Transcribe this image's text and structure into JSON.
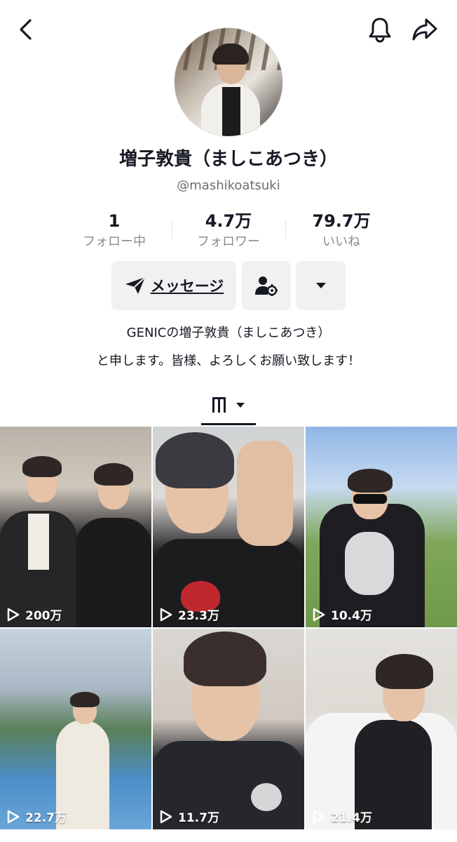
{
  "profile": {
    "display_name": "増子敦貴（ましこあつき）",
    "handle": "@mashikoatsuki",
    "stats": [
      {
        "value": "1",
        "label": "フォロー中"
      },
      {
        "value": "4.7万",
        "label": "フォロワー"
      },
      {
        "value": "79.7万",
        "label": "いいね"
      }
    ],
    "bio_lines": [
      "GENICの増子敦貴（ましこあつき）",
      "と申します。皆様、よろしくお願い致します！"
    ]
  },
  "actions": {
    "message_label": "メッセージ"
  },
  "icons": {
    "back": "chevron-left-icon",
    "notifications": "bell-icon",
    "share": "share-arrow-icon",
    "message": "send-icon",
    "add_friend": "person-settings-icon",
    "more": "caret-down-icon",
    "videos_tab": "grid-icon",
    "view_count": "play-icon"
  },
  "videos": [
    {
      "views": "200万"
    },
    {
      "views": "23.3万"
    },
    {
      "views": "10.4万"
    },
    {
      "views": "22.7万"
    },
    {
      "views": "11.7万"
    },
    {
      "views": "21.4万"
    }
  ],
  "colors": {
    "text_primary": "#161823",
    "text_secondary": "#8a8b91",
    "button_bg": "#f1f1f2"
  }
}
